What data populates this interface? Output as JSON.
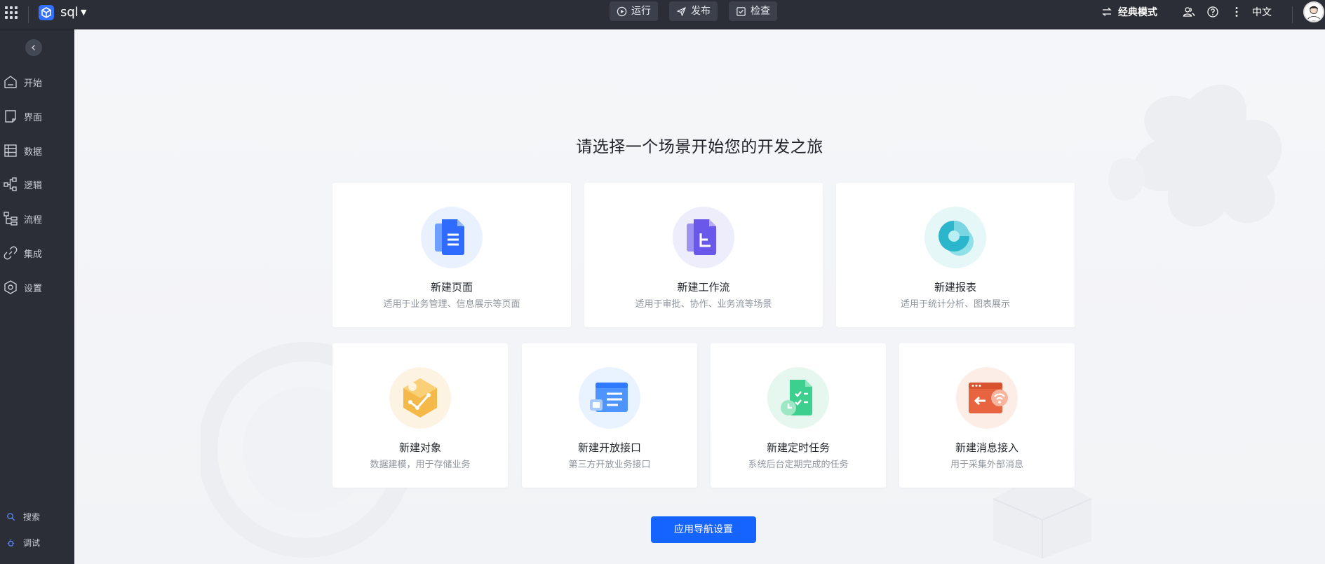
{
  "topbar": {
    "app_name": "sql",
    "run_label": "运行",
    "publish_label": "发布",
    "check_label": "检查",
    "mode_label": "经典模式",
    "lang_label": "中文"
  },
  "sidebar": {
    "items": [
      {
        "label": "开始",
        "icon": "home-icon"
      },
      {
        "label": "界面",
        "icon": "page-icon"
      },
      {
        "label": "数据",
        "icon": "table-icon"
      },
      {
        "label": "逻辑",
        "icon": "logic-icon"
      },
      {
        "label": "流程",
        "icon": "flow-icon"
      },
      {
        "label": "集成",
        "icon": "link-icon"
      },
      {
        "label": "设置",
        "icon": "settings-icon"
      }
    ],
    "bottom": [
      {
        "label": "搜索",
        "icon": "search-icon"
      },
      {
        "label": "调试",
        "icon": "debug-icon"
      }
    ]
  },
  "main": {
    "title": "请选择一个场景开始您的开发之旅",
    "cards": [
      {
        "title": "新建页面",
        "desc": "适用于业务管理、信息展示等页面",
        "icon": "page-doc-icon"
      },
      {
        "title": "新建工作流",
        "desc": "适用于审批、协作、业务流等场景",
        "icon": "workflow-doc-icon"
      },
      {
        "title": "新建报表",
        "desc": "适用于统计分析、图表展示",
        "icon": "pie-chart-icon"
      },
      {
        "title": "新建对象",
        "desc": "数据建模，用于存储业务",
        "icon": "object-cube-icon"
      },
      {
        "title": "新建开放接口",
        "desc": "第三方开放业务接口",
        "icon": "api-window-icon"
      },
      {
        "title": "新建定时任务",
        "desc": "系统后台定期完成的任务",
        "icon": "timer-task-icon"
      },
      {
        "title": "新建消息接入",
        "desc": "用于采集外部消息",
        "icon": "message-inbound-icon"
      }
    ],
    "nav_settings_label": "应用导航设置"
  },
  "colors": {
    "accent": "#1664ff",
    "sidebar_bg": "#2b2e36"
  }
}
